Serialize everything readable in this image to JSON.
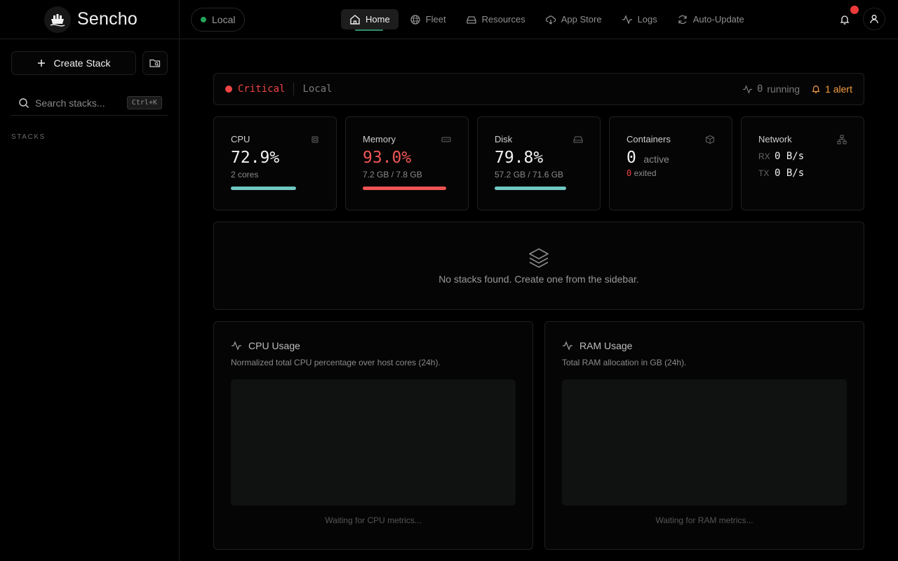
{
  "app": {
    "name": "Sencho"
  },
  "sidebar": {
    "create_label": "Create Stack",
    "search_placeholder": "Search stacks...",
    "search_shortcut": "Ctrl+K",
    "section_label": "STACKS"
  },
  "topbar": {
    "node_label": "Local",
    "nav": [
      {
        "label": "Home",
        "icon": "home-icon",
        "active": true
      },
      {
        "label": "Fleet",
        "icon": "fleet-icon"
      },
      {
        "label": "Resources",
        "icon": "resources-icon"
      },
      {
        "label": "App Store",
        "icon": "cloud-download-icon"
      },
      {
        "label": "Logs",
        "icon": "activity-icon"
      },
      {
        "label": "Auto-Update",
        "icon": "refresh-icon"
      }
    ]
  },
  "status": {
    "level": "Critical",
    "node": "Local",
    "running_count": "0",
    "running_label": "running",
    "alert_text": "1 alert"
  },
  "metrics": {
    "cpu": {
      "label": "CPU",
      "value": "72.9%",
      "sub": "2 cores",
      "fraction": 0.729,
      "color": "#6fc7c2"
    },
    "memory": {
      "label": "Memory",
      "value": "93.0%",
      "sub": "7.2 GB / 7.8 GB",
      "fraction": 0.93,
      "color": "#ef5555"
    },
    "disk": {
      "label": "Disk",
      "value": "79.8%",
      "sub": "57.2 GB / 71.6 GB",
      "fraction": 0.798,
      "color": "#6fc7c2"
    },
    "containers": {
      "label": "Containers",
      "active_count": "0",
      "active_word": "active",
      "exited_count": "0",
      "exited_word": "exited"
    },
    "network": {
      "label": "Network",
      "rx_key": "RX",
      "rx_value": "0 B/s",
      "tx_key": "TX",
      "tx_value": "0 B/s"
    }
  },
  "empty_state": {
    "text": "No stacks found. Create one from the sidebar."
  },
  "charts": {
    "cpu": {
      "title": "CPU Usage",
      "description": "Normalized total CPU percentage over host cores (24h).",
      "waiting": "Waiting for CPU metrics..."
    },
    "ram": {
      "title": "RAM Usage",
      "description": "Total RAM allocation in GB (24h).",
      "waiting": "Waiting for RAM metrics..."
    }
  },
  "colors": {
    "critical": "#ef4444",
    "alert": "#f59e42",
    "healthy": "#6fc7c2",
    "accent": "#2f8c68"
  }
}
